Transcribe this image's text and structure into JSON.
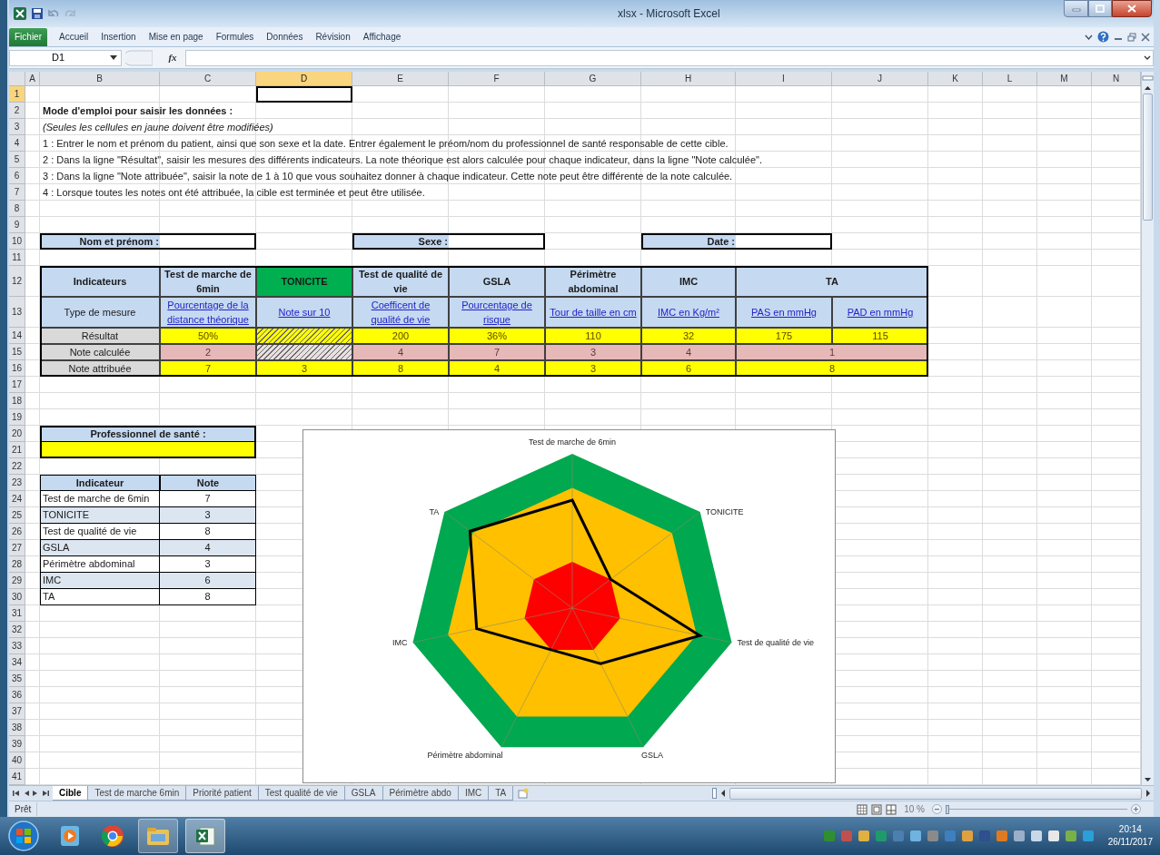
{
  "window": {
    "title": "xlsx - Microsoft Excel"
  },
  "ribbon_tabs": [
    {
      "label": "Fichier",
      "kind": "file"
    },
    {
      "label": "Accueil",
      "kind": "tab"
    },
    {
      "label": "Insertion",
      "kind": "tab"
    },
    {
      "label": "Mise en page",
      "kind": "tab"
    },
    {
      "label": "Formules",
      "kind": "tab"
    },
    {
      "label": "Données",
      "kind": "tab"
    },
    {
      "label": "Révision",
      "kind": "tab"
    },
    {
      "label": "Affichage",
      "kind": "tab"
    }
  ],
  "name_box": "D1",
  "function_button": "fx",
  "columns": [
    {
      "label": "A",
      "selected": false
    },
    {
      "label": "B",
      "selected": false
    },
    {
      "label": "C",
      "selected": false
    },
    {
      "label": "D",
      "selected": true
    },
    {
      "label": "E",
      "selected": false
    },
    {
      "label": "F",
      "selected": false
    },
    {
      "label": "G",
      "selected": false
    },
    {
      "label": "H",
      "selected": false
    },
    {
      "label": "I",
      "selected": false
    },
    {
      "label": "J",
      "selected": false
    },
    {
      "label": "K",
      "selected": false
    },
    {
      "label": "L",
      "selected": false
    },
    {
      "label": "M",
      "selected": false
    },
    {
      "label": "N",
      "selected": false
    }
  ],
  "row_headers": [
    {
      "label": "1",
      "selected": true
    },
    {
      "label": "2",
      "selected": false
    },
    {
      "label": "3",
      "selected": false
    },
    {
      "label": "4",
      "selected": false
    },
    {
      "label": "5",
      "selected": false
    },
    {
      "label": "6",
      "selected": false
    },
    {
      "label": "7",
      "selected": false
    },
    {
      "label": "8",
      "selected": false
    },
    {
      "label": "9",
      "selected": false
    },
    {
      "label": "10",
      "selected": false
    },
    {
      "label": "11",
      "selected": false
    },
    {
      "label": "12",
      "selected": false
    },
    {
      "label": "13",
      "selected": false
    },
    {
      "label": "14",
      "selected": false
    },
    {
      "label": "15",
      "selected": false
    },
    {
      "label": "16",
      "selected": false
    },
    {
      "label": "17",
      "selected": false
    },
    {
      "label": "18",
      "selected": false
    },
    {
      "label": "19",
      "selected": false
    },
    {
      "label": "20",
      "selected": false
    },
    {
      "label": "21",
      "selected": false
    },
    {
      "label": "22",
      "selected": false
    },
    {
      "label": "23",
      "selected": false
    },
    {
      "label": "24",
      "selected": false
    },
    {
      "label": "25",
      "selected": false
    },
    {
      "label": "26",
      "selected": false
    },
    {
      "label": "27",
      "selected": false
    },
    {
      "label": "28",
      "selected": false
    },
    {
      "label": "29",
      "selected": false
    },
    {
      "label": "30",
      "selected": false
    },
    {
      "label": "31",
      "selected": false
    },
    {
      "label": "32",
      "selected": false
    },
    {
      "label": "33",
      "selected": false
    },
    {
      "label": "34",
      "selected": false
    },
    {
      "label": "35",
      "selected": false
    },
    {
      "label": "36",
      "selected": false
    },
    {
      "label": "37",
      "selected": false
    },
    {
      "label": "38",
      "selected": false
    },
    {
      "label": "39",
      "selected": false
    },
    {
      "label": "40",
      "selected": false
    },
    {
      "label": "41",
      "selected": false
    }
  ],
  "instructions": {
    "title": "Mode d'emploi pour saisir les données :",
    "note": "(Seules les cellules en jaune doivent être modifiées)",
    "steps": [
      "1 : Entrer le nom et prénom du patient, ainsi que son sexe et la date. Entrer également le préom/nom du professionnel de santé responsable de cette cible.",
      "2 : Dans la ligne \"Résultat\", saisir les mesures des différents indicateurs. La note théorique est alors calculée pour chaque indicateur, dans la ligne \"Note calculée\".",
      "3 : Dans la ligne \"Note attribuée\", saisir la note de 1 à 10 que vous souhaitez donner à chaque indicateur. Cette note peut être différente de la note calculée.",
      "4 : Lorsque toutes les notes ont été attribuée, la cible est terminée et peut être utilisée."
    ]
  },
  "patient_fields": [
    {
      "label": "Nom et prénom :"
    },
    {
      "label": "Sexe :"
    },
    {
      "label": "Date :"
    }
  ],
  "indicator_table": {
    "header_label": "Indicateurs",
    "measure_label": "Type de mesure",
    "row_labels": [
      "Résultat",
      "Note calculée",
      "Note attribuée"
    ],
    "indicators": [
      {
        "name": "Test de marche de 6min",
        "highlighted": false,
        "calculated": true,
        "measures": [
          {
            "label": "Pourcentage de la distance théorique",
            "result": "50%"
          }
        ],
        "note_calculee": "2",
        "note_attribuee": "7"
      },
      {
        "name": "TONICITE",
        "highlighted": true,
        "calculated": false,
        "measures": [
          {
            "label": "Note sur 10"
          }
        ],
        "note_attribuee": "3"
      },
      {
        "name": "Test de qualité de vie",
        "highlighted": false,
        "calculated": true,
        "measures": [
          {
            "label": "Coefficent de qualité de vie",
            "result": "200"
          }
        ],
        "note_calculee": "4",
        "note_attribuee": "8"
      },
      {
        "name": "GSLA",
        "highlighted": false,
        "calculated": true,
        "measures": [
          {
            "label": "Pourcentage de risque",
            "result": "36%"
          }
        ],
        "note_calculee": "7",
        "note_attribuee": "4"
      },
      {
        "name": "Périmètre abdominal",
        "highlighted": false,
        "calculated": true,
        "measures": [
          {
            "label": "Tour de taille en cm",
            "result": "110"
          }
        ],
        "note_calculee": "3",
        "note_attribuee": "3"
      },
      {
        "name": "IMC",
        "highlighted": false,
        "calculated": true,
        "measures": [
          {
            "label": "IMC en Kg/m²",
            "result": "32"
          }
        ],
        "note_calculee": "4",
        "note_attribuee": "6"
      },
      {
        "name": "TA",
        "highlighted": false,
        "calculated": true,
        "measures": [
          {
            "label": "PAS en mmHg",
            "result": "175"
          },
          {
            "label": "PAD en mmHg",
            "result": "115"
          }
        ],
        "note_calculee": "1",
        "note_attribuee": "8"
      }
    ]
  },
  "professional": {
    "label": "Professionnel de santé :"
  },
  "summary_table": {
    "columns": [
      "Indicateur",
      "Note"
    ],
    "rows": [
      {
        "indicator": "Test de marche de 6min",
        "note": "7"
      },
      {
        "indicator": "TONICITE",
        "note": "3"
      },
      {
        "indicator": "Test de qualité de vie",
        "note": "8"
      },
      {
        "indicator": "GSLA",
        "note": "4"
      },
      {
        "indicator": "Périmètre abdominal",
        "note": "3"
      },
      {
        "indicator": "IMC",
        "note": "6"
      },
      {
        "indicator": "TA",
        "note": "8"
      }
    ]
  },
  "radar_chart": {
    "axis_labels": [
      "Test de marche de 6min",
      "TONICITE",
      "Test de qualité de vie",
      "GSLA",
      "Périmètre abdominal",
      "IMC",
      "TA"
    ]
  },
  "sheet_tabs": [
    {
      "label": "Cible",
      "selected": true
    },
    {
      "label": "Test de marche 6min",
      "selected": false
    },
    {
      "label": "Priorité patient",
      "selected": false
    },
    {
      "label": "Test qualité de vie",
      "selected": false
    },
    {
      "label": "GSLA",
      "selected": false
    },
    {
      "label": "Périmètre abdo",
      "selected": false
    },
    {
      "label": "IMC",
      "selected": false
    },
    {
      "label": "TA",
      "selected": false
    }
  ],
  "status_bar": {
    "status": "Prêt",
    "zoom": "10 %",
    "zoom_slider": {
      "level": 0
    }
  },
  "taskbar": {
    "time": "20:14",
    "date": "26/11/2017"
  }
}
